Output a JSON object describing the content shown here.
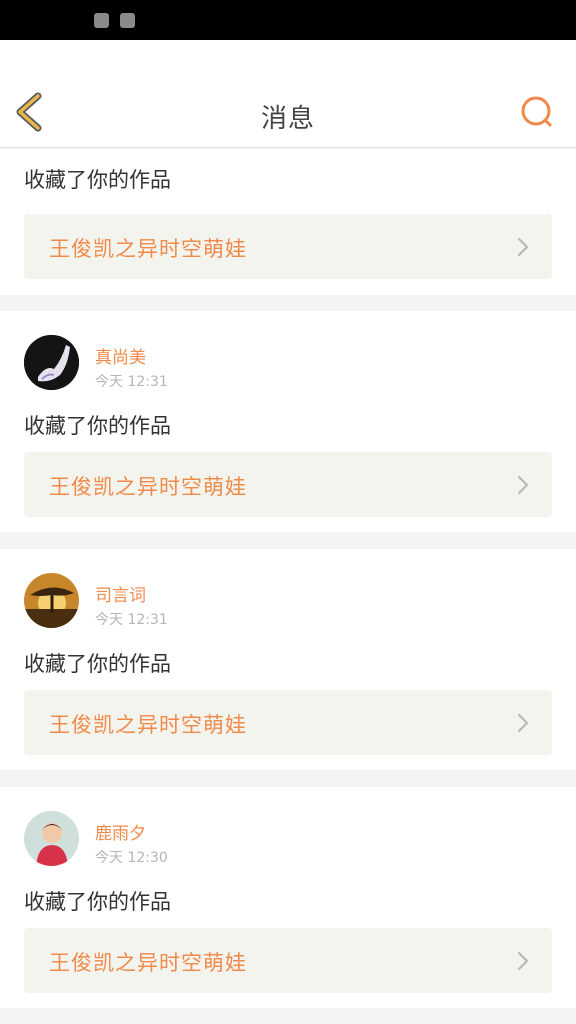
{
  "header": {
    "title": "消息"
  },
  "messages": [
    {
      "user": "",
      "time": "",
      "action": "收藏了你的作品",
      "work": "王俊凯之异时空萌娃"
    },
    {
      "user": "真尚美",
      "time": "今天 12:31",
      "action": "收藏了你的作品",
      "work": "王俊凯之异时空萌娃"
    },
    {
      "user": "司言词",
      "time": "今天 12:31",
      "action": "收藏了你的作品",
      "work": "王俊凯之异时空萌娃"
    },
    {
      "user": "鹿雨夕",
      "time": "今天 12:30",
      "action": "收藏了你的作品",
      "work": "王俊凯之异时空萌娃"
    }
  ],
  "colors": {
    "accent": "#f08a4b",
    "back_icon": "#e8b84a",
    "link_bg": "#f4f4ee"
  }
}
